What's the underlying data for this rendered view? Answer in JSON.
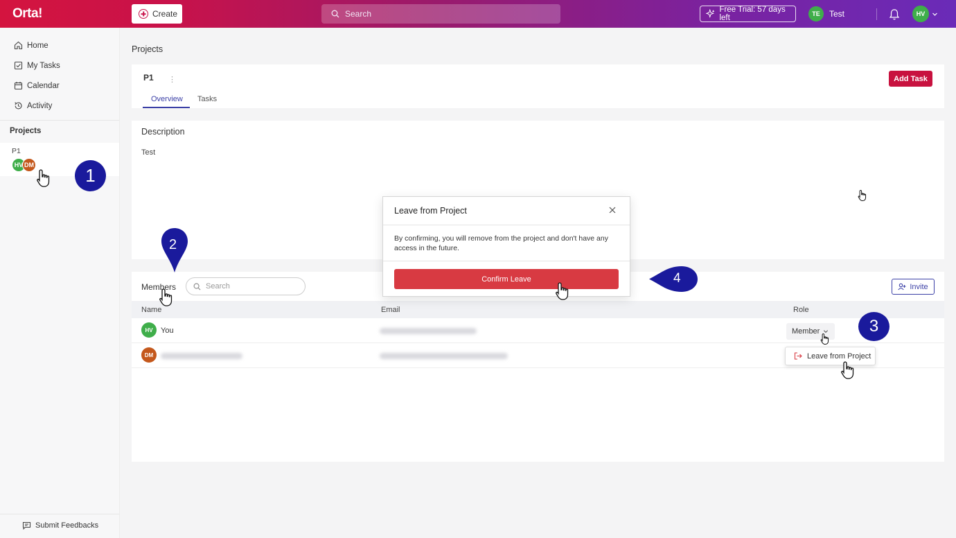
{
  "header": {
    "logo": "Orta!",
    "create_label": "Create",
    "search_placeholder": "Search",
    "trial_label": "Free Trial: 57 days left",
    "workspace_initials": "TE",
    "workspace_name": "Test",
    "user_initials": "HV"
  },
  "sidebar": {
    "items": [
      {
        "label": "Home",
        "icon": "home-icon"
      },
      {
        "label": "My Tasks",
        "icon": "checkbox-icon"
      },
      {
        "label": "Calendar",
        "icon": "calendar-icon"
      },
      {
        "label": "Activity",
        "icon": "history-icon"
      }
    ],
    "projects_heading": "Projects",
    "project": {
      "name": "P1",
      "members": [
        "HV",
        "DM"
      ]
    },
    "feedback_label": "Submit Feedbacks"
  },
  "main": {
    "page_title": "Projects",
    "project_name": "P1",
    "tabs": [
      "Overview",
      "Tasks"
    ],
    "add_task_label": "Add Task",
    "description_title": "Description",
    "description_text": "Test",
    "members": {
      "title": "Members",
      "search_placeholder": "Search",
      "invite_label": "Invite",
      "columns": [
        "Name",
        "Email",
        "Role"
      ],
      "rows": [
        {
          "initials": "HV",
          "name": "You",
          "role": "Member"
        },
        {
          "initials": "DM",
          "name": ""
        }
      ],
      "dropdown_option": "Leave from Project"
    }
  },
  "modal": {
    "title": "Leave from Project",
    "body": "By confirming, you will remove from the project and don't have any access in the future.",
    "confirm_label": "Confirm Leave"
  },
  "steps": [
    "1",
    "2",
    "3",
    "4"
  ],
  "colors": {
    "brand_red": "#c8123f",
    "accent_indigo": "#3a3fa6",
    "confirm_red": "#d83a42",
    "marker_blue": "#1a1a9c",
    "avatar_green": "#3fae4a",
    "avatar_orange": "#c4581c"
  }
}
